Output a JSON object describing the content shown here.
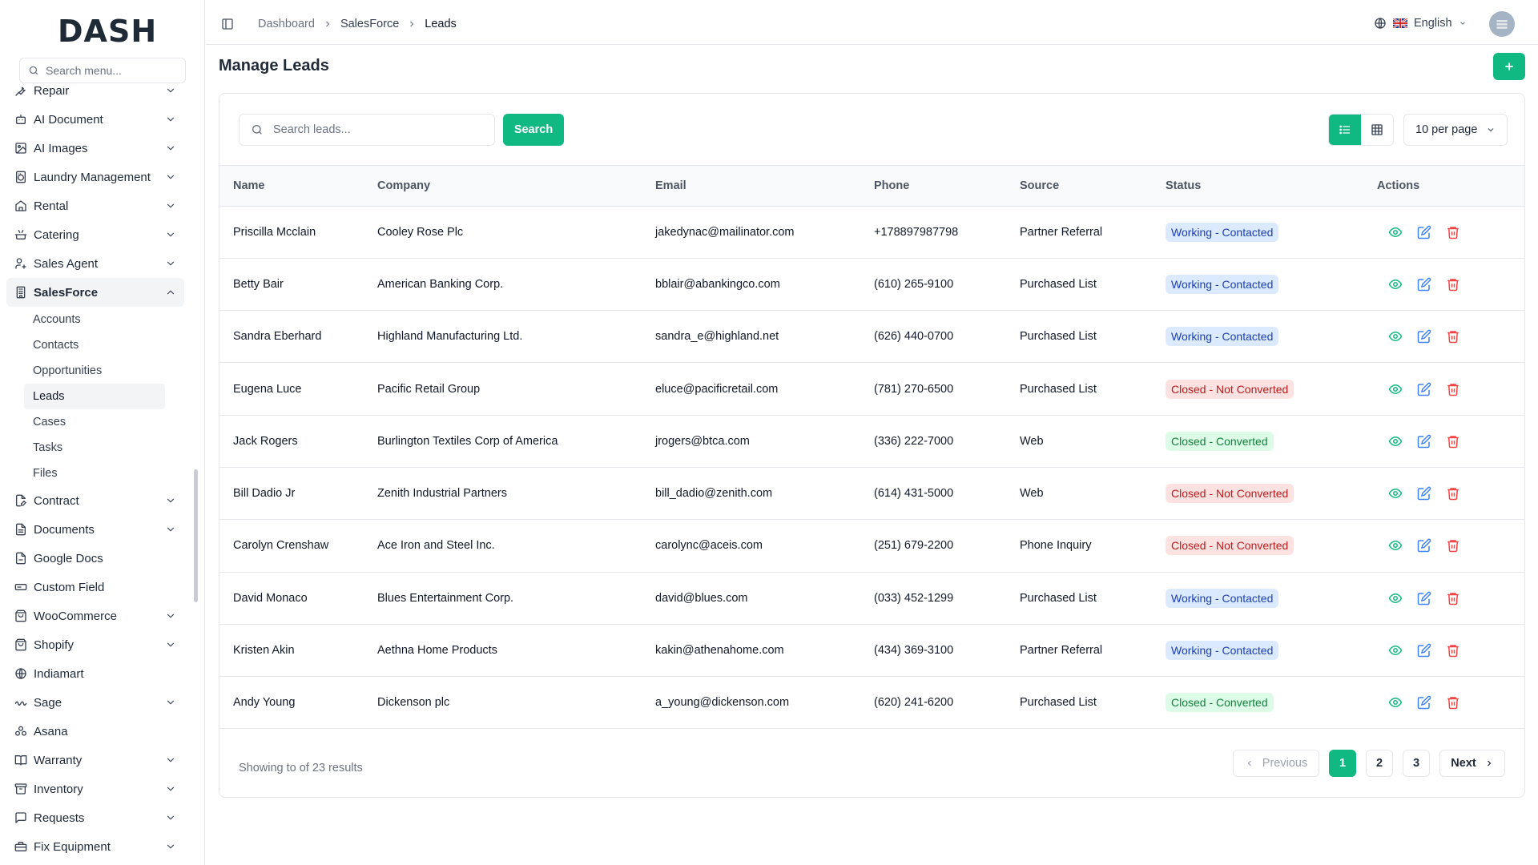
{
  "app": {
    "logo_text_left": "D",
    "logo_text_right": "ASH"
  },
  "sidebar": {
    "search_placeholder": "Search menu...",
    "items": [
      {
        "label": "Repair",
        "icon": "wrench-icon",
        "chevron": true
      },
      {
        "label": "AI Document",
        "icon": "robot-icon",
        "chevron": true
      },
      {
        "label": "AI Images",
        "icon": "image-icon",
        "chevron": true
      },
      {
        "label": "Laundry Management",
        "icon": "washing-machine-icon",
        "chevron": true
      },
      {
        "label": "Rental",
        "icon": "home-icon",
        "chevron": true
      },
      {
        "label": "Catering",
        "icon": "cooking-pot-icon",
        "chevron": true
      },
      {
        "label": "Sales Agent",
        "icon": "user-cog-icon",
        "chevron": true
      },
      {
        "label": "SalesForce",
        "icon": "building-icon",
        "chevron": true,
        "expanded": true
      },
      {
        "label": "Contract",
        "icon": "file-pen-icon",
        "chevron": true
      },
      {
        "label": "Documents",
        "icon": "file-text-icon",
        "chevron": true
      },
      {
        "label": "Google Docs",
        "icon": "file-icon",
        "chevron": false
      },
      {
        "label": "Custom Field",
        "icon": "input-field-icon",
        "chevron": false
      },
      {
        "label": "WooCommerce",
        "icon": "shopping-bag-icon",
        "chevron": true
      },
      {
        "label": "Shopify",
        "icon": "shopping-bag-icon",
        "chevron": true
      },
      {
        "label": "Indiamart",
        "icon": "globe-icon",
        "chevron": false
      },
      {
        "label": "Sage",
        "icon": "sage-logo-icon",
        "chevron": true
      },
      {
        "label": "Asana",
        "icon": "asana-icon",
        "chevron": false
      },
      {
        "label": "Warranty",
        "icon": "book-icon",
        "chevron": true
      },
      {
        "label": "Inventory",
        "icon": "archive-icon",
        "chevron": true
      },
      {
        "label": "Requests",
        "icon": "message-square-icon",
        "chevron": true
      },
      {
        "label": "Fix Equipment",
        "icon": "toolbox-icon",
        "chevron": true
      }
    ],
    "salesforce_sub": [
      "Accounts",
      "Contacts",
      "Opportunities",
      "Leads",
      "Cases",
      "Tasks",
      "Files"
    ],
    "active_sub": "Leads"
  },
  "topbar": {
    "breadcrumb": [
      "Dashboard",
      "SalesForce",
      "Leads"
    ],
    "language": "English"
  },
  "page": {
    "title": "Manage Leads"
  },
  "toolbar": {
    "search_placeholder": "Search leads...",
    "search_label": "Search",
    "per_page": "10 per page"
  },
  "table": {
    "headers": [
      "Name",
      "Company",
      "Email",
      "Phone",
      "Source",
      "Status",
      "Actions"
    ],
    "rows": [
      {
        "name": "Priscilla Mcclain",
        "company": "Cooley Rose Plc",
        "email": "jakedynac@mailinator.com",
        "phone": "+178897987798",
        "source": "Partner Referral",
        "status": "Working - Contacted",
        "status_type": "working"
      },
      {
        "name": "Betty Bair",
        "company": "American Banking Corp.",
        "email": "bblair@abankingco.com",
        "phone": "(610) 265-9100",
        "source": "Purchased List",
        "status": "Working - Contacted",
        "status_type": "working"
      },
      {
        "name": "Sandra Eberhard",
        "company": "Highland Manufacturing Ltd.",
        "email": "sandra_e@highland.net",
        "phone": "(626) 440-0700",
        "source": "Purchased List",
        "status": "Working - Contacted",
        "status_type": "working"
      },
      {
        "name": "Eugena Luce",
        "company": "Pacific Retail Group",
        "email": "eluce@pacificretail.com",
        "phone": "(781) 270-6500",
        "source": "Purchased List",
        "status": "Closed - Not Converted",
        "status_type": "not_converted"
      },
      {
        "name": "Jack Rogers",
        "company": "Burlington Textiles Corp of America",
        "email": "jrogers@btca.com",
        "phone": "(336) 222-7000",
        "source": "Web",
        "status": "Closed - Converted",
        "status_type": "converted"
      },
      {
        "name": "Bill Dadio Jr",
        "company": "Zenith Industrial Partners",
        "email": "bill_dadio@zenith.com",
        "phone": "(614) 431-5000",
        "source": "Web",
        "status": "Closed - Not Converted",
        "status_type": "not_converted"
      },
      {
        "name": "Carolyn Crenshaw",
        "company": "Ace Iron and Steel Inc.",
        "email": "carolync@aceis.com",
        "phone": "(251) 679-2200",
        "source": "Phone Inquiry",
        "status": "Closed - Not Converted",
        "status_type": "not_converted"
      },
      {
        "name": "David Monaco",
        "company": "Blues Entertainment Corp.",
        "email": "david@blues.com",
        "phone": "(033) 452-1299",
        "source": "Purchased List",
        "status": "Working - Contacted",
        "status_type": "working"
      },
      {
        "name": "Kristen Akin",
        "company": "Aethna Home Products",
        "email": "kakin@athenahome.com",
        "phone": "(434) 369-3100",
        "source": "Partner Referral",
        "status": "Working - Contacted",
        "status_type": "working"
      },
      {
        "name": "Andy Young",
        "company": "Dickenson plc",
        "email": "a_young@dickenson.com",
        "phone": "(620) 241-6200",
        "source": "Purchased List",
        "status": "Closed - Converted",
        "status_type": "converted"
      }
    ]
  },
  "status_colors": {
    "working": {
      "bg": "#dbeafe",
      "fg": "#1e40af"
    },
    "not_converted": {
      "bg": "#fee2e2",
      "fg": "#b91c1c"
    },
    "converted": {
      "bg": "#dcfce7",
      "fg": "#15803d"
    }
  },
  "pagination": {
    "summary": "Showing to of 23 results",
    "previous": "Previous",
    "next": "Next",
    "pages": [
      "1",
      "2",
      "3"
    ],
    "current": "1"
  },
  "colors": {
    "accent": "#10b981"
  }
}
